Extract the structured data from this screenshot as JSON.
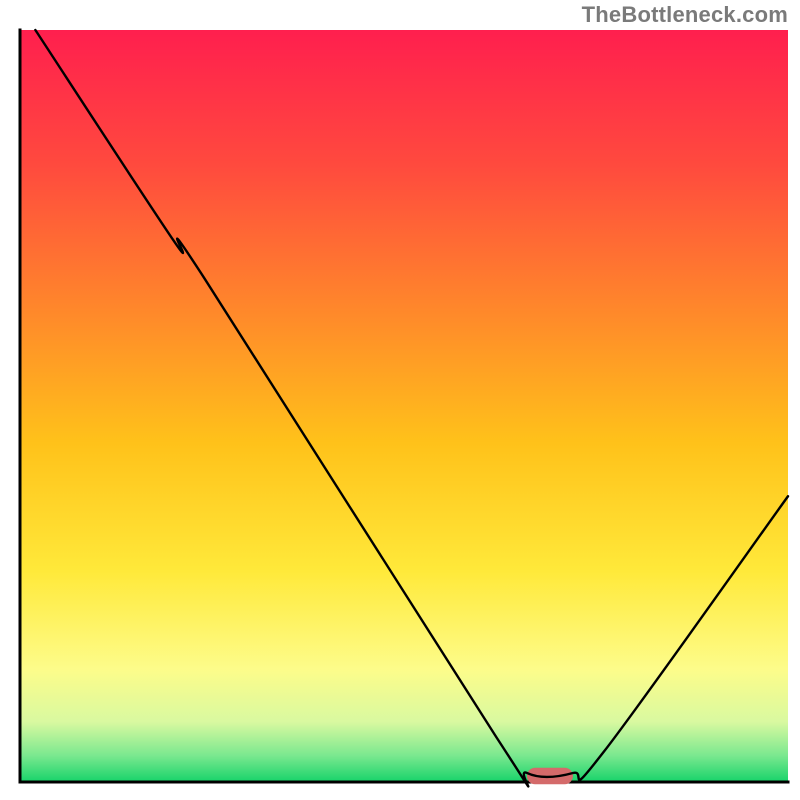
{
  "watermark": "TheBottleneck.com",
  "chart_data": {
    "type": "line",
    "title": "",
    "xlabel": "",
    "ylabel": "",
    "xlim": [
      0,
      100
    ],
    "ylim": [
      0,
      100
    ],
    "grid": false,
    "legend": false,
    "background": {
      "type": "vertical-gradient",
      "stops": [
        {
          "pos": 0.0,
          "color": "#ff1f4e"
        },
        {
          "pos": 0.18,
          "color": "#ff4a3e"
        },
        {
          "pos": 0.38,
          "color": "#ff8a2a"
        },
        {
          "pos": 0.55,
          "color": "#ffc21a"
        },
        {
          "pos": 0.72,
          "color": "#ffe93a"
        },
        {
          "pos": 0.85,
          "color": "#fdfc8a"
        },
        {
          "pos": 0.92,
          "color": "#d9f9a0"
        },
        {
          "pos": 0.965,
          "color": "#7ae88f"
        },
        {
          "pos": 1.0,
          "color": "#17d36a"
        }
      ]
    },
    "series": [
      {
        "name": "bottleneck-curve",
        "color": "#000000",
        "width": 2.4,
        "points": [
          {
            "x": 2,
            "y": 100
          },
          {
            "x": 20,
            "y": 72
          },
          {
            "x": 24,
            "y": 67
          },
          {
            "x": 62,
            "y": 6
          },
          {
            "x": 66,
            "y": 1.2
          },
          {
            "x": 72,
            "y": 1.2
          },
          {
            "x": 76,
            "y": 4
          },
          {
            "x": 100,
            "y": 38
          }
        ]
      }
    ],
    "marker": {
      "name": "optimal-region",
      "shape": "pill",
      "color": "#d46a6a",
      "x_center": 69,
      "y": 0.8,
      "width_x": 6,
      "height_y": 2.2
    },
    "axes": {
      "color": "#000000",
      "width": 3
    }
  }
}
